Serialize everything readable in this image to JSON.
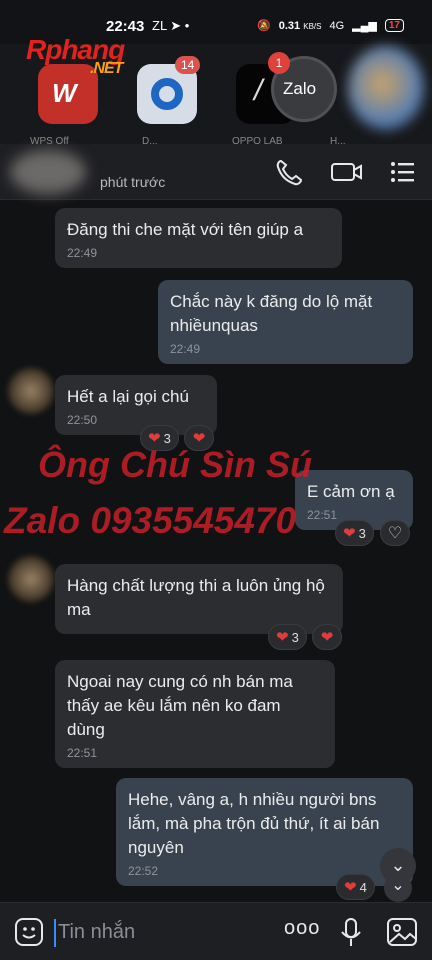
{
  "status_bar": {
    "time": "22:43",
    "icons": "ZL ➤ •",
    "network_speed": "0.31",
    "network_unit": "KB/S",
    "signal": "4G",
    "battery": "17"
  },
  "watermark_logo": {
    "main": "Rphang",
    "suffix": ".NET"
  },
  "launcher": {
    "zalo_label": "Zalo",
    "zalo_badge": "1",
    "app_badge": "14",
    "labels": [
      "WPS Off",
      "D...",
      "OPPO LAB",
      "H..."
    ]
  },
  "chat_header": {
    "status_text": "phút trước",
    "call_icon": "phone-icon",
    "video_icon": "video-call-icon",
    "menu_icon": "menu-icon"
  },
  "messages": [
    {
      "direction": "in",
      "text": "Đăng thi che mặt với tên giúp a",
      "time": "22:49"
    },
    {
      "direction": "out",
      "text": "Chắc này k đăng do lộ mặt nhiềunquas",
      "time": "22:49"
    },
    {
      "direction": "in",
      "text": "Hết a lại gọi chú",
      "time": "22:50",
      "reactions": {
        "count": "3"
      }
    },
    {
      "direction": "out",
      "text": "E cảm ơn ạ",
      "time": "22:51",
      "reactions": {
        "count": "3"
      }
    },
    {
      "direction": "in",
      "text": "Hàng chất lượng thi a luôn ủng hộ ma",
      "time": "",
      "reactions": {
        "count": "3"
      }
    },
    {
      "direction": "in",
      "text": "Ngoai nay cung có nh bán ma thấy ae kêu lắm nên ko đam dùng",
      "time": "22:51"
    },
    {
      "direction": "out",
      "text": "Hehe, vâng a, h nhiều người bns lắm, mà pha trộn đủ thứ, ít ai bán nguyên",
      "time": "22:52",
      "reactions": {
        "count": "4"
      }
    }
  ],
  "overlay_watermark": {
    "line1": "Ông Chú Sìn Sú",
    "line2": "Zalo 0935545470"
  },
  "input_bar": {
    "placeholder": "Tin nhắn",
    "more_label": "ooo"
  },
  "colors": {
    "background": "#111214",
    "incoming_bubble": "#2c2d31",
    "outgoing_bubble": "#38434f",
    "heart": "#e23b3b",
    "watermark": "#c81e28"
  }
}
